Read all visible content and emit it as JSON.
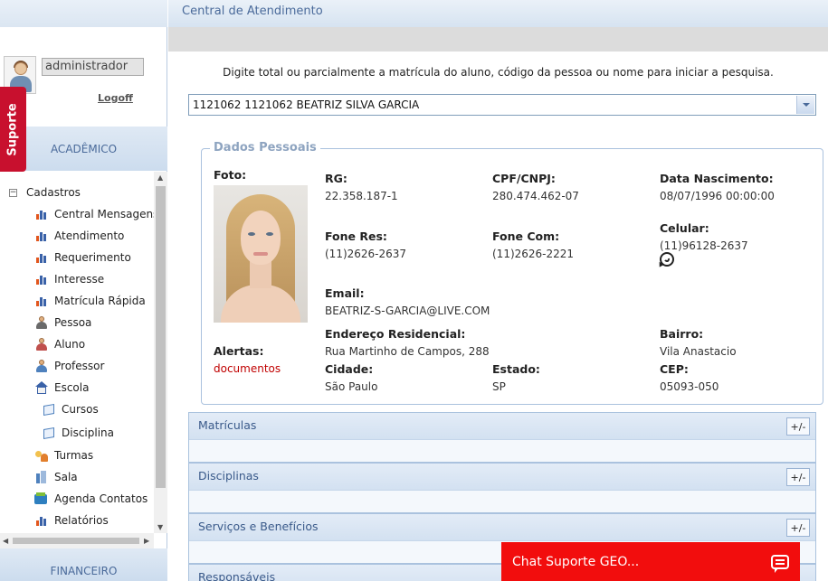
{
  "app": {
    "header_title": "Central de Atendimento"
  },
  "sidebar": {
    "user_field": "administrador",
    "logoff": "Logoff",
    "suporte_tab": "Suporte",
    "section_academico": "ACADÊMICO",
    "section_financeiro": "FINANCEIRO",
    "tree": {
      "root": "Cadastros",
      "items": [
        {
          "label": "Central Mensagens",
          "icon": "bar-chart-icon"
        },
        {
          "label": "Atendimento",
          "icon": "bar-chart-icon"
        },
        {
          "label": "Requerimento",
          "icon": "bar-chart-icon"
        },
        {
          "label": "Interesse",
          "icon": "bar-chart-icon"
        },
        {
          "label": "Matrícula Rápida",
          "icon": "bar-chart-icon"
        },
        {
          "label": "Pessoa",
          "icon": "person-icon"
        },
        {
          "label": "Aluno",
          "icon": "student-icon"
        },
        {
          "label": "Professor",
          "icon": "teacher-icon"
        },
        {
          "label": "Escola",
          "icon": "school-icon"
        },
        {
          "label": "Cursos",
          "icon": "course-icon"
        },
        {
          "label": "Disciplina",
          "icon": "book-icon"
        },
        {
          "label": "Turmas",
          "icon": "group-icon"
        },
        {
          "label": "Sala",
          "icon": "room-icon"
        },
        {
          "label": "Agenda Contatos",
          "icon": "agenda-icon"
        },
        {
          "label": "Relatórios",
          "icon": "bar-chart-icon"
        }
      ]
    }
  },
  "main": {
    "instruction": "Digite total ou parcialmente a matrícula do aluno, código da pessoa ou nome para iniciar a pesquisa.",
    "search_value": "1121062 1121062 BEATRIZ SILVA GARCIA",
    "personal": {
      "legend": "Dados Pessoais",
      "foto_label": "Foto:",
      "alertas_label": "Alertas:",
      "alertas_value": "documentos",
      "rg_label": "RG:",
      "rg": "22.358.187-1",
      "cpf_label": "CPF/CNPJ:",
      "cpf": "280.474.462-07",
      "nasc_label": "Data Nascimento:",
      "nasc": "08/07/1996 00:00:00",
      "fone_res_label": "Fone Res:",
      "fone_res": "(11)2626-2637",
      "fone_com_label": "Fone Com:",
      "fone_com": "(11)2626-2221",
      "celular_label": "Celular:",
      "celular": "(11)96128-2637",
      "email_label": "Email:",
      "email": "BEATRIZ-S-GARCIA@LIVE.COM",
      "endereco_label": "Endereço Residencial:",
      "endereco": "Rua Martinho de Campos, 288",
      "bairro_label": "Bairro:",
      "bairro": "Vila Anastacio",
      "cidade_label": "Cidade:",
      "cidade": "São Paulo",
      "estado_label": "Estado:",
      "estado": "SP",
      "cep_label": "CEP:",
      "cep": "05093-050"
    },
    "panels": [
      {
        "title": "Matrículas",
        "toggle": "+/-"
      },
      {
        "title": "Disciplinas",
        "toggle": "+/-"
      },
      {
        "title": "Serviços e Benefícios",
        "toggle": "+/-"
      },
      {
        "title": "Responsáveis"
      }
    ]
  },
  "chat": {
    "label": "Chat Suporte GEO..."
  },
  "colors": {
    "accent": "#4a6a9a",
    "chat": "#f20d0d",
    "suporte": "#c8102e",
    "alert": "#c00000"
  }
}
